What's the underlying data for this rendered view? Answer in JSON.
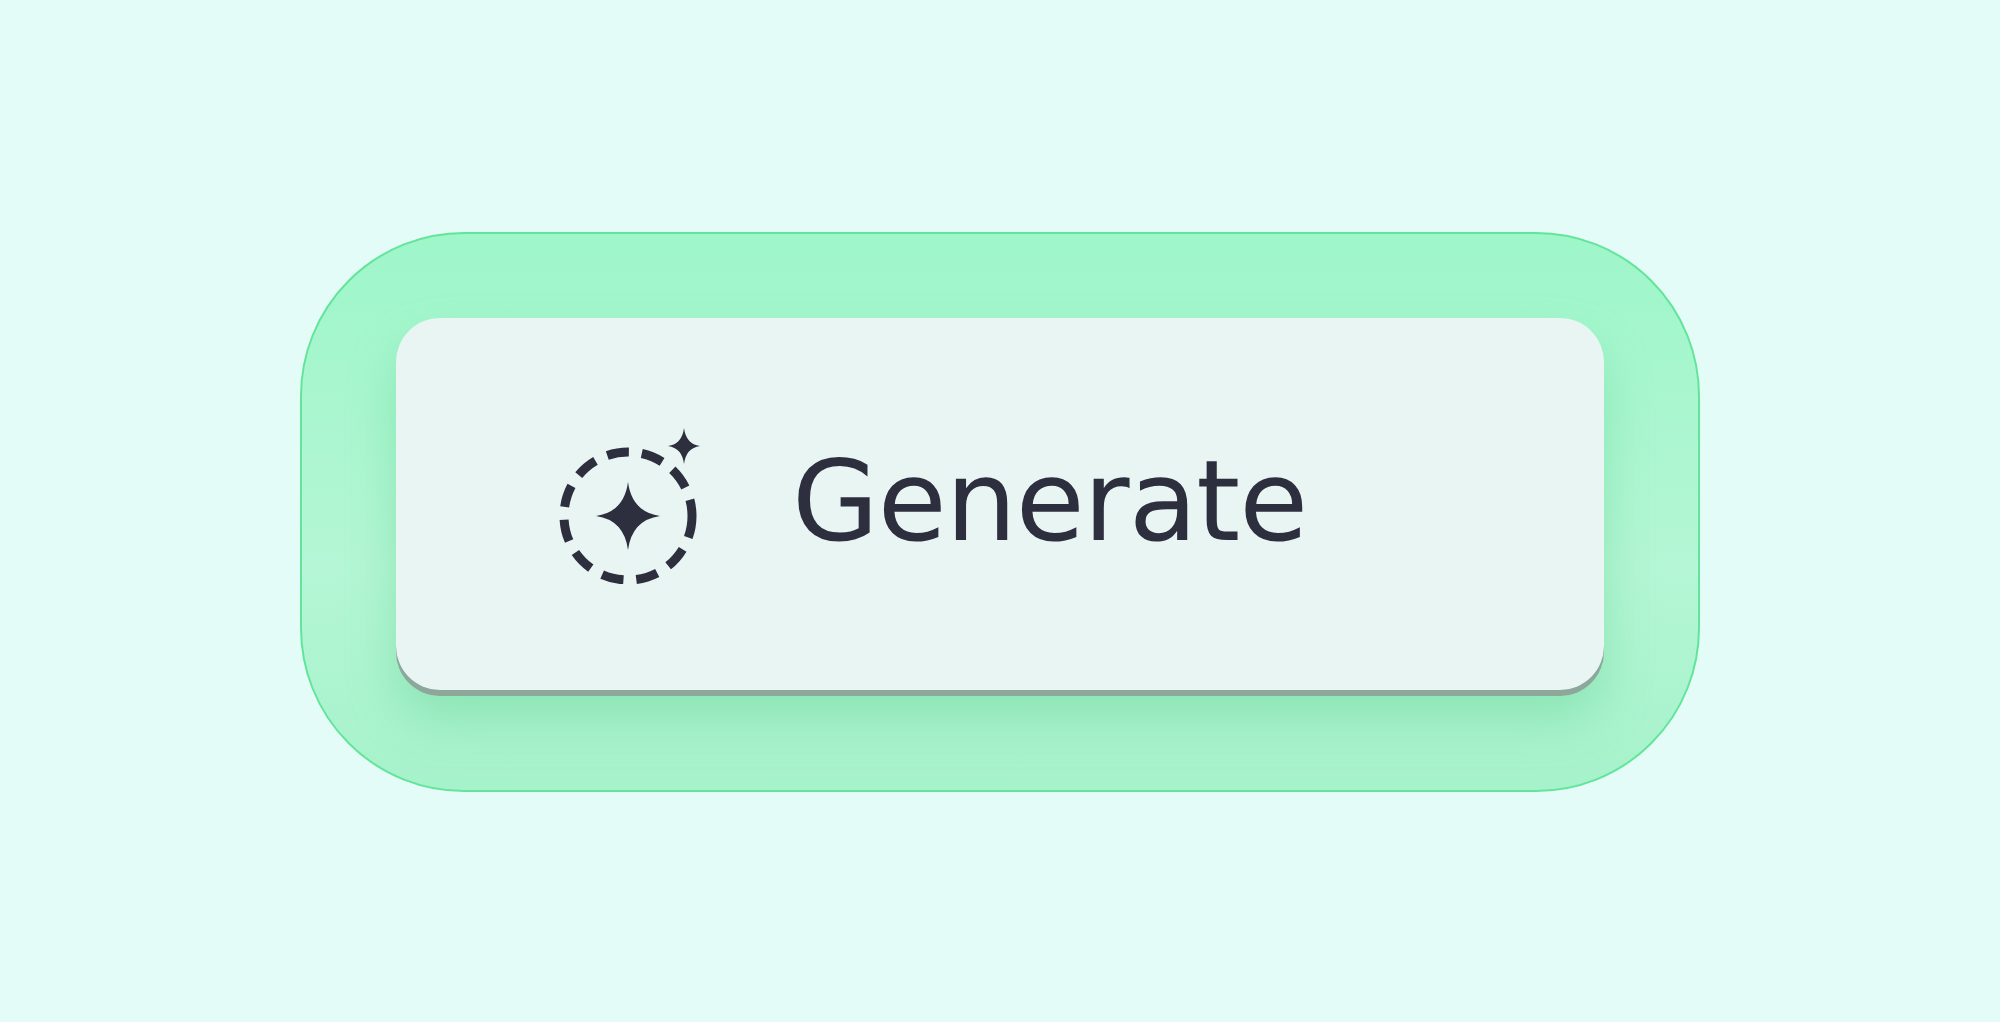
{
  "button": {
    "label": "Generate"
  }
}
